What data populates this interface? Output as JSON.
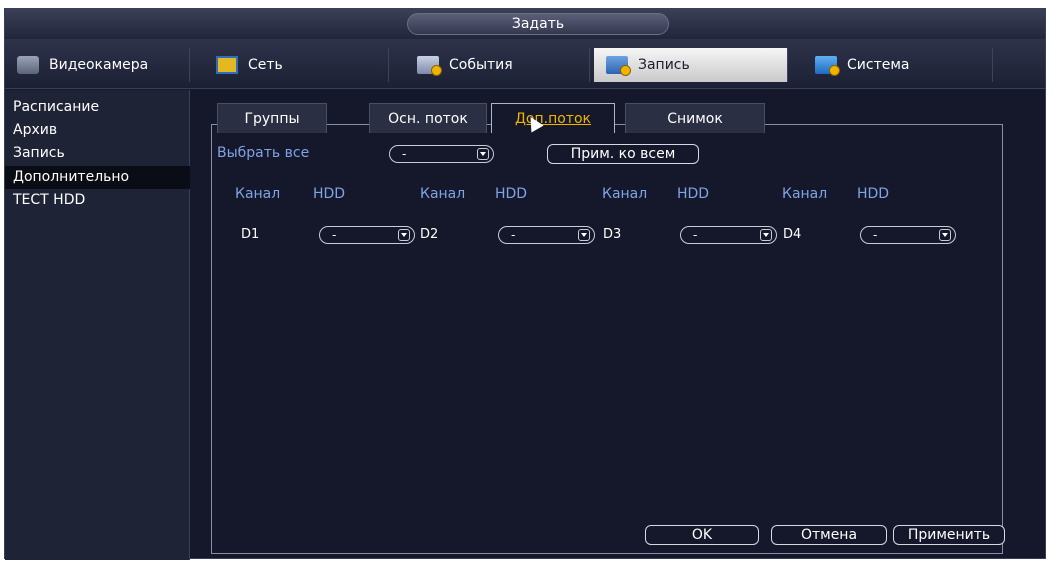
{
  "window": {
    "title": "Задать"
  },
  "menu": [
    {
      "label": "Видеокамера",
      "icon": "camera-icon",
      "active": false
    },
    {
      "label": "Сеть",
      "icon": "network-icon",
      "active": false
    },
    {
      "label": "События",
      "icon": "events-icon",
      "active": false
    },
    {
      "label": "Запись",
      "icon": "record-icon",
      "active": true
    },
    {
      "label": "Система",
      "icon": "system-icon",
      "active": false
    }
  ],
  "sidebar": {
    "items": [
      {
        "label": "Расписание",
        "active": false
      },
      {
        "label": "Архив",
        "active": false
      },
      {
        "label": "Запись",
        "active": false
      },
      {
        "label": "Дополнительно",
        "active": true
      },
      {
        "label": "ТЕСТ HDD",
        "active": false
      }
    ]
  },
  "tabs": [
    {
      "label": "Группы",
      "active": false
    },
    {
      "label": "Осн. поток",
      "active": false
    },
    {
      "label": "Доп.поток",
      "active": true
    },
    {
      "label": "Снимок",
      "active": false
    }
  ],
  "select_all": {
    "label": "Выбрать все",
    "value": "-",
    "apply_all_label": "Прим. ко всем"
  },
  "columns": {
    "channel_header": "Канал",
    "hdd_header": "HDD"
  },
  "channels": [
    {
      "name": "D1",
      "hdd": "-"
    },
    {
      "name": "D2",
      "hdd": "-"
    },
    {
      "name": "D3",
      "hdd": "-"
    },
    {
      "name": "D4",
      "hdd": "-"
    }
  ],
  "buttons": {
    "ok": "OK",
    "cancel": "Отмена",
    "apply": "Применить"
  },
  "colors": {
    "background": "#15182a",
    "label_blue": "#7fa3e6",
    "accent_yellow": "#f0b400"
  }
}
